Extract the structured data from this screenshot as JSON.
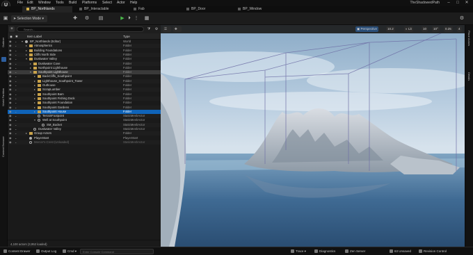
{
  "menubar": {
    "logo": "U",
    "items": [
      "File",
      "Edit",
      "Window",
      "Tools",
      "Build",
      "Platforms",
      "Select",
      "Actor",
      "Help"
    ],
    "project_name": "TheShadowedPath",
    "window_controls": [
      "–",
      "□",
      "✕"
    ]
  },
  "tabs": [
    {
      "label": "BP_Northlands",
      "active": true
    },
    {
      "label": "BP_Interactable",
      "active": false
    },
    {
      "label": "Fab",
      "active": false
    },
    {
      "label": "BP_Door",
      "active": false
    },
    {
      "label": "BP_Window",
      "active": false
    }
  ],
  "toolbar": {
    "mode_label": "Selection Mode",
    "play_icon": "play-icon"
  },
  "left_strip": [
    "Outliner",
    "World Partition",
    "Content Browser"
  ],
  "outliner": {
    "search_placeholder": "Search...",
    "columns": {
      "label": "Item Label",
      "type": "Type"
    },
    "rows": [
      {
        "label": "BP_Northlands (Editor)",
        "type": "World",
        "depth": 0,
        "kind": "world",
        "arrow": "▾"
      },
      {
        "label": "Atmospherics",
        "type": "Folder",
        "depth": 1,
        "kind": "folder",
        "arrow": "▸"
      },
      {
        "label": "Building Foundations",
        "type": "Folder",
        "depth": 1,
        "kind": "folder",
        "arrow": "▸"
      },
      {
        "label": "Cliffs North Side",
        "type": "Folder",
        "depth": 1,
        "kind": "folder",
        "arrow": "▸"
      },
      {
        "label": "Duskwater Valley",
        "type": "Folder",
        "depth": 1,
        "kind": "folder",
        "arrow": "▾"
      },
      {
        "label": "Duskwater Cove",
        "type": "Folder",
        "depth": 2,
        "kind": "folder",
        "arrow": "▸"
      },
      {
        "label": "Northpoint Lighthouse",
        "type": "Folder",
        "depth": 2,
        "kind": "folder",
        "arrow": "▸"
      },
      {
        "label": "Southpoint Lighthouse",
        "type": "Folder",
        "depth": 2,
        "kind": "folder",
        "arrow": "▾",
        "highlight": true
      },
      {
        "label": "BackCliffs_Southpoint",
        "type": "Folder",
        "depth": 3,
        "kind": "folder",
        "arrow": "▸"
      },
      {
        "label": "Lighthouse_Southpoint_Tower",
        "type": "Folder",
        "depth": 3,
        "kind": "folder",
        "arrow": "▸"
      },
      {
        "label": "Outhouse",
        "type": "Folder",
        "depth": 3,
        "kind": "folder",
        "arrow": "▸"
      },
      {
        "label": "ScrapLumber",
        "type": "Folder",
        "depth": 3,
        "kind": "folder",
        "arrow": "▸"
      },
      {
        "label": "Southpoint Barn",
        "type": "Folder",
        "depth": 3,
        "kind": "folder",
        "arrow": "▸"
      },
      {
        "label": "Southpoint Fishing Dock",
        "type": "Folder",
        "depth": 3,
        "kind": "folder",
        "arrow": "▸"
      },
      {
        "label": "Southpoint Foundation",
        "type": "Folder",
        "depth": 3,
        "kind": "folder",
        "arrow": "▸"
      },
      {
        "label": "Southpoint Gardens",
        "type": "Folder",
        "depth": 3,
        "kind": "folder",
        "arrow": "▸"
      },
      {
        "label": "Southpoint House",
        "type": "Folder",
        "depth": 3,
        "kind": "folder",
        "arrow": "▸",
        "selected": true
      },
      {
        "label": "TerrainFootpoint",
        "type": "StaticMeshActor",
        "depth": 3,
        "kind": "mesh",
        "arrow": ""
      },
      {
        "label": "Well at Southpoint",
        "type": "StaticMeshActor",
        "depth": 3,
        "kind": "mesh",
        "arrow": "▾"
      },
      {
        "label": "SM_Bucket",
        "type": "StaticMeshActor",
        "depth": 4,
        "kind": "mesh",
        "arrow": ""
      },
      {
        "label": "Duskwater Valley",
        "type": "StaticMeshActor",
        "depth": 2,
        "kind": "mesh",
        "arrow": ""
      },
      {
        "label": "Group Actors",
        "type": "Folder",
        "depth": 1,
        "kind": "folder",
        "arrow": "▸"
      },
      {
        "label": "PlayerStart",
        "type": "PlayerStart",
        "depth": 1,
        "kind": "actor",
        "arrow": ""
      },
      {
        "label": "Mercer's Crest (Unloaded)",
        "type": "StaticMeshActor",
        "depth": 1,
        "kind": "mesh",
        "arrow": "",
        "dim": true
      }
    ],
    "status": "4,100 actors (3,952 loaded)"
  },
  "viewport": {
    "perspective_label": "Perspective",
    "lit_label": "Lit",
    "fov_label": "10.2",
    "grid_value": "10",
    "angle_value": "10°",
    "scale_value": "0.25",
    "camera_speed": "4"
  },
  "right_strip": [
    "Place Actors",
    "Details"
  ],
  "bottombar": {
    "content_drawer": "Content Drawer",
    "output_log": "Output Log",
    "cmd_label": "Cmd",
    "cmd_placeholder": "Enter Console Command",
    "trace": "Trace",
    "derived_data": "Diagnostics",
    "zen_server": "Zen Server",
    "unsaved": "63 Unsaved",
    "revision_control": "Revision Control"
  },
  "colors": {
    "selection": "#0f63b8",
    "folder": "#c9a24a",
    "play": "#49b84a"
  }
}
